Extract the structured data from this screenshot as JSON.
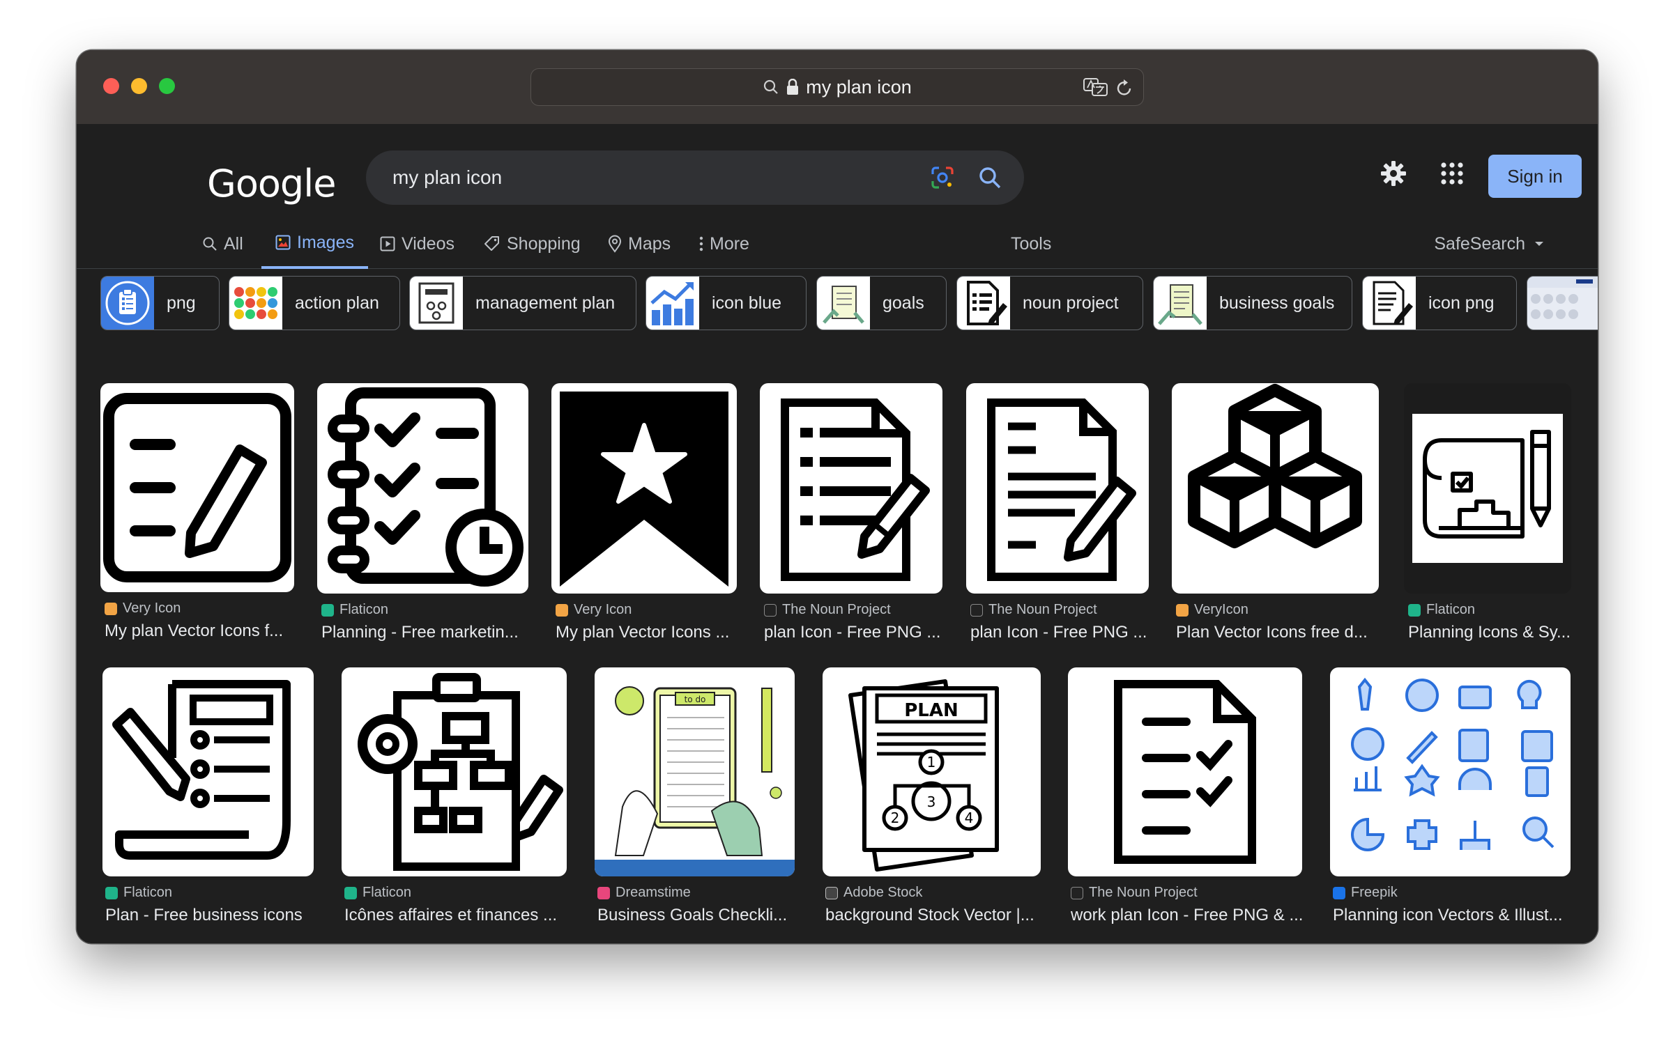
{
  "browser": {
    "url_text": "my plan icon"
  },
  "header": {
    "logo": "Google",
    "search_value": "my plan icon",
    "signin_label": "Sign in"
  },
  "tabs": {
    "all": "All",
    "images": "Images",
    "videos": "Videos",
    "shopping": "Shopping",
    "maps": "Maps",
    "more": "More",
    "tools": "Tools",
    "safesearch": "SafeSearch"
  },
  "chips": [
    {
      "label": "png"
    },
    {
      "label": "action plan"
    },
    {
      "label": "management plan"
    },
    {
      "label": "icon blue"
    },
    {
      "label": "goals"
    },
    {
      "label": "noun project"
    },
    {
      "label": "business goals"
    },
    {
      "label": "icon png"
    }
  ],
  "results_row1": [
    {
      "source": "Very Icon",
      "title": "My plan Vector Icons f..."
    },
    {
      "source": "Flaticon",
      "title": "Planning - Free marketin..."
    },
    {
      "source": "Very Icon",
      "title": "My plan Vector Icons ..."
    },
    {
      "source": "The Noun Project",
      "title": "plan Icon - Free PNG ..."
    },
    {
      "source": "The Noun Project",
      "title": "plan Icon - Free PNG ..."
    },
    {
      "source": "VeryIcon",
      "title": "Plan Vector Icons free d..."
    },
    {
      "source": "Flaticon",
      "title": "Planning Icons & Sy..."
    }
  ],
  "results_row2": [
    {
      "source": "Flaticon",
      "title": "Plan - Free business icons"
    },
    {
      "source": "Flaticon",
      "title": "Icônes affaires et finances ..."
    },
    {
      "source": "Dreamstime",
      "title": "Business Goals Checkli..."
    },
    {
      "source": "Adobe Stock",
      "title": "background Stock Vector |..."
    },
    {
      "source": "The Noun Project",
      "title": "work plan Icon - Free PNG & ..."
    },
    {
      "source": "Freepik",
      "title": "Planning icon Vectors & Illust..."
    }
  ],
  "image_text": {
    "plan_doc": "PLAN",
    "todo": "to do"
  },
  "colors": {
    "accent": "#8ab4f8",
    "background": "#1f1f1f",
    "search_bg": "#303134",
    "flaticon": "#1fb48a",
    "dreamstime": "#e8467c",
    "freepik": "#1a73e8",
    "chip_blue": "#3d7be0"
  }
}
